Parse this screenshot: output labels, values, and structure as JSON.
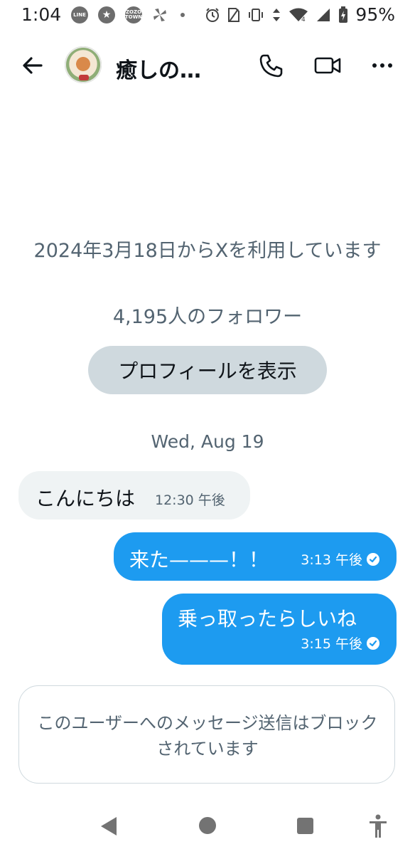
{
  "status_bar": {
    "time": "1:04",
    "icons": [
      {
        "name": "line-icon",
        "label": "LINE"
      },
      {
        "name": "star-icon",
        "label": "★"
      },
      {
        "name": "zozotown-icon",
        "label": "ZOZO TOWN"
      }
    ],
    "battery": "95%",
    "network_label": "4"
  },
  "header": {
    "title": "癒しの…"
  },
  "profile": {
    "joined": "2024年3月18日からXを利用しています",
    "followers": "4,195人のフォロワー",
    "view_profile_label": "プロフィールを表示"
  },
  "date_divider": "Wed, Aug 19",
  "messages": [
    {
      "direction": "received",
      "text": "こんにちは",
      "time": "12:30 午後"
    },
    {
      "direction": "sent",
      "text": "来た———！！",
      "time": "3:13 午後",
      "read": true
    },
    {
      "direction": "sent",
      "text": "乗っ取ったらしいね",
      "time": "3:15 午後",
      "read": true
    }
  ],
  "blocked_notice": "このユーザーへのメッセージ送信はブロックされています",
  "colors": {
    "accent": "#1d9bf0",
    "secondary_text": "#536471",
    "received_bubble": "#eff3f4",
    "button_bg": "#cfd9de"
  }
}
